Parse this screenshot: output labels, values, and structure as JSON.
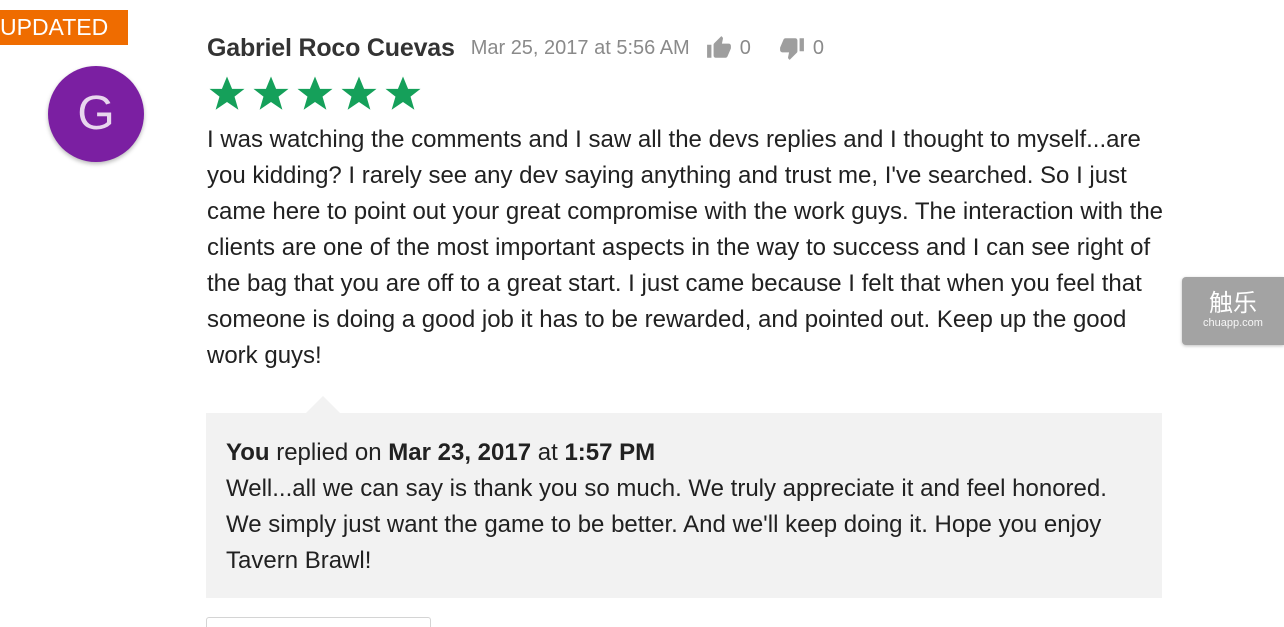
{
  "badge": {
    "label": "UPDATED"
  },
  "review": {
    "avatar_letter": "G",
    "author": "Gabriel Roco Cuevas",
    "date": "Mar 25, 2017 at 5:56 AM",
    "thumbs_up_count": "0",
    "thumbs_down_count": "0",
    "rating": 5,
    "rating_max": 5,
    "text": "I was watching the comments and I saw all the devs replies and I thought to myself...are you kidding? I rarely see any dev saying anything and trust me, I've searched. So I just came here to point out your great compromise with the work guys. The interaction with the clients are one of the most important aspects in the way to success and I can see right of the bag that you are off to a great start. I just came because I felt that when you feel that someone is doing a good job it has to be rewarded, and pointed out. Keep up the good work guys!"
  },
  "reply": {
    "who": "You",
    "replied_on": " replied on ",
    "date": "Mar 23, 2017",
    "at": " at ",
    "time": "1:57 PM",
    "text": "Well...all we can say is thank you so much. We truly appreciate it and feel honored. We simply just want the game to be better. And we'll keep doing it. Hope you enjoy Tavern Brawl!"
  },
  "watermark": {
    "title": "触乐",
    "subtitle": "chuapp.com"
  },
  "colors": {
    "badge": "#ef6c00",
    "avatar": "#7b1fa2",
    "star": "#15a05a",
    "reply_bg": "#f2f2f2",
    "muted_text": "#8a8a8a"
  },
  "icons": [
    "thumbs-up-icon",
    "thumbs-down-icon",
    "star-icon"
  ]
}
